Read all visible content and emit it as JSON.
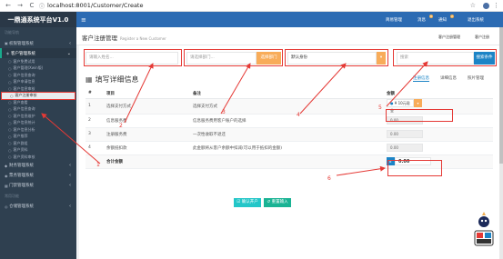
{
  "browser": {
    "back": "←",
    "forward": "→",
    "reload": "C",
    "info": "ⓘ",
    "url": "localhost:8001/Customer/Create",
    "star": "☆",
    "more": "⋮"
  },
  "sidebar": {
    "title": "一鼎通系统平台V1.0",
    "section1": "功能导航",
    "groups": [
      {
        "icon": "▣",
        "label": "权限管理系统"
      },
      {
        "icon": "◈",
        "label": "客户管理系统"
      }
    ],
    "subitems": [
      "客户免费试用",
      "客户管理(Xwin版)",
      "客户信息查询",
      "客户申请信息",
      "客户信息审核",
      "客户注册审核",
      "客户查看",
      "客户信息查询",
      "客户信息维护",
      "客户信息统计",
      "客户信息分析",
      "客户推荐",
      "客户群组",
      "客户资料",
      "客户资料审核"
    ],
    "current": "客户注册审核",
    "groups2": [
      {
        "icon": "◆",
        "label": "财务管理系统"
      },
      {
        "icon": "◉",
        "label": "票务管理系统"
      },
      {
        "icon": "▦",
        "label": "门禁管理系统"
      }
    ],
    "section2": "常用功能",
    "groups3": [
      {
        "icon": "◎",
        "label": "仓储管理系统"
      }
    ]
  },
  "topbar": {
    "menu": "≡",
    "link1": "简易管理",
    "msgs": "消息",
    "badge1": "8",
    "notify": "通知",
    "badge2": "2",
    "user": "退出系统"
  },
  "crumb": {
    "title": "客户注册管理",
    "subtitle": "Register a New Customer",
    "c1": "客户注册管理",
    "c2": "客户注册"
  },
  "form": {
    "name_ph": "请输入姓名...",
    "dept_ph": "请选择部门...",
    "dept_btn": "选择部门",
    "role_ph": "默认身份",
    "search_ph": "搜索",
    "search_btn": "搜索条件"
  },
  "page": {
    "title": "填写详细信息",
    "tab1": "注册信息",
    "tab2": "详细信息",
    "tab3": "照片管理"
  },
  "table": {
    "headers": [
      "#",
      "项目",
      "备注",
      "金额"
    ],
    "rows": [
      {
        "n": "1",
        "item": "选择支付方式",
        "note": "选择支付方式",
        "select": "¥ 10元现金"
      },
      {
        "n": "2",
        "item": "信息服务费",
        "note": "信息服务费用客户账户的选择",
        "amount": "0.00"
      },
      {
        "n": "3",
        "item": "注册服务费",
        "note": "一次性收取不退还",
        "amount": "0.00"
      },
      {
        "n": "4",
        "item": "余额抵扣款",
        "note": "此金额将从客户余额中扣减(可以用于抵扣的金额)",
        "amount": "0.00"
      }
    ],
    "total_label": "合计金额",
    "total": "0.00"
  },
  "buttons": {
    "confirm": "☑ 确认开户",
    "reset": "↺ 重置输入"
  },
  "annotations": [
    "1",
    "2",
    "3",
    "4",
    "5",
    "6"
  ],
  "colors": {
    "sidebar": "#2f4050",
    "topbar": "#2c6bb3",
    "accent": "#1c84c6",
    "orange": "#f8ac59",
    "red": "#e53935"
  }
}
